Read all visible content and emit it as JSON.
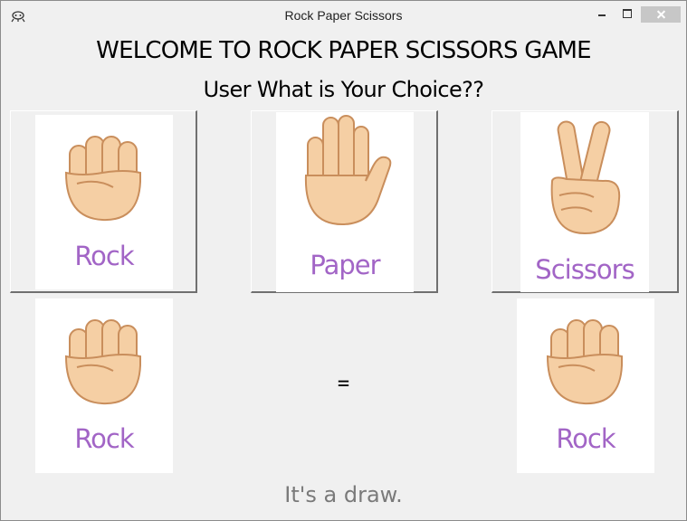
{
  "window": {
    "title": "Rock Paper Scissors"
  },
  "header": {
    "welcome": "WELCOME TO ROCK PAPER SCISSORS GAME",
    "prompt": "User What is Your Choice??"
  },
  "choices": [
    {
      "label": "Rock",
      "icon": "fist-icon"
    },
    {
      "label": "Paper",
      "icon": "open-hand-icon"
    },
    {
      "label": "Scissors",
      "icon": "victory-hand-icon"
    }
  ],
  "match": {
    "user": {
      "label": "Rock",
      "icon": "fist-icon"
    },
    "comparator": "=",
    "computer": {
      "label": "Rock",
      "icon": "fist-icon"
    },
    "result": "It's a draw."
  },
  "colors": {
    "label": "#a265c6",
    "skin": "#f5cfa4",
    "result_text": "#7a7a7a"
  }
}
